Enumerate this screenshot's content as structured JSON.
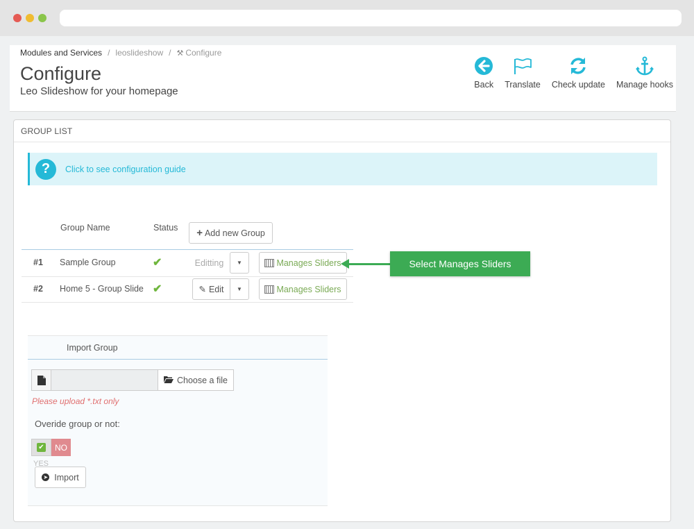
{
  "breadcrumb": {
    "item1": "Modules and Services",
    "item2": "leoslideshow",
    "item3": "Configure",
    "separator": "/"
  },
  "header": {
    "title": "Configure",
    "subtitle": "Leo Slideshow for your homepage"
  },
  "toolbar": {
    "back": "Back",
    "translate": "Translate",
    "check_update": "Check update",
    "manage_hooks": "Manage hooks",
    "icon_color": "#25b9d7"
  },
  "panel": {
    "heading": "GROUP LIST",
    "info_icon": "?",
    "guide_link": "Click to see configuration guide"
  },
  "table": {
    "col_group_name": "Group Name",
    "col_status": "Status",
    "add_button": "Add new Group",
    "rows": [
      {
        "id": "#1",
        "name": "Sample Group",
        "status": "enabled",
        "edit_label": "Editting",
        "manage_label": "Manages Sliders"
      },
      {
        "id": "#2",
        "name": "Home 5 - Group Slide",
        "status": "enabled",
        "edit_label": "Edit",
        "manage_label": "Manages Sliders"
      }
    ]
  },
  "callout": {
    "text": "Select Manages Sliders",
    "color": "#3cab54"
  },
  "import": {
    "title": "Import Group",
    "choose_file": "Choose a file",
    "upload_note": "Please upload *.txt only",
    "override_label": "Overide group or not:",
    "toggle_no": "NO",
    "toggle_yes": "YES",
    "import_button": "Import"
  }
}
